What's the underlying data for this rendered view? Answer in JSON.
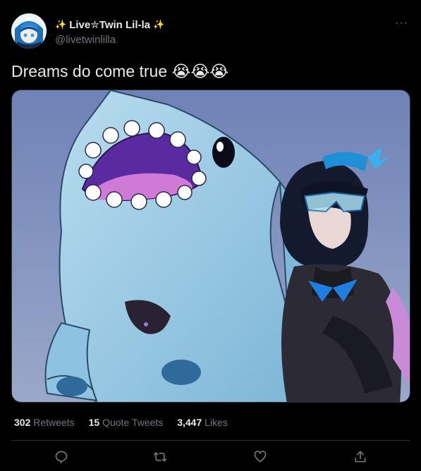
{
  "author": {
    "display_name": "Live✮Twin Lil-la",
    "sparkle_left": "✨",
    "sparkle_right": "✨",
    "handle": "@livetwinlilla"
  },
  "more_label": "···",
  "tweet": {
    "text": "Dreams do come true 😭😭😭"
  },
  "stats": {
    "retweets_count": "302",
    "retweets_label": "Retweets",
    "quotes_count": "15",
    "quotes_label": "Quote Tweets",
    "likes_count": "3,447",
    "likes_label": "Likes"
  },
  "actions": [
    "reply-icon",
    "retweet-icon",
    "like-icon",
    "share-icon"
  ],
  "colors": {
    "background": "#000000",
    "text": "#e7e9ea",
    "muted": "#71767b",
    "divider": "#2f3336"
  }
}
